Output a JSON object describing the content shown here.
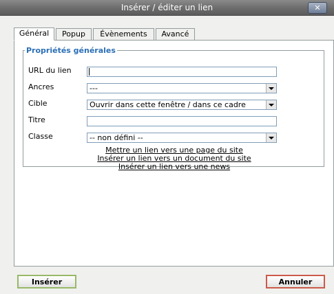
{
  "window": {
    "title": "Insérer / éditer un lien",
    "close_label": "✕"
  },
  "tabs": [
    {
      "label": "Général"
    },
    {
      "label": "Popup"
    },
    {
      "label": "Évènements"
    },
    {
      "label": "Avancé"
    }
  ],
  "properties": {
    "legend": "Propriétés générales",
    "url_label": "URL du lien",
    "url_value": "",
    "anchors_label": "Ancres",
    "anchors_value": "---",
    "target_label": "Cible",
    "target_value": "Ouvrir dans cette fenêtre / dans ce cadre",
    "title_label": "Titre",
    "title_value": "",
    "class_label": "Classe",
    "class_value": "-- non défini --"
  },
  "links": [
    "Mettre un lien vers une page du site",
    "Insérer un lien vers un document du site",
    "Insérer un lien vers une news"
  ],
  "buttons": {
    "insert": "Insérer",
    "cancel": "Annuler"
  }
}
